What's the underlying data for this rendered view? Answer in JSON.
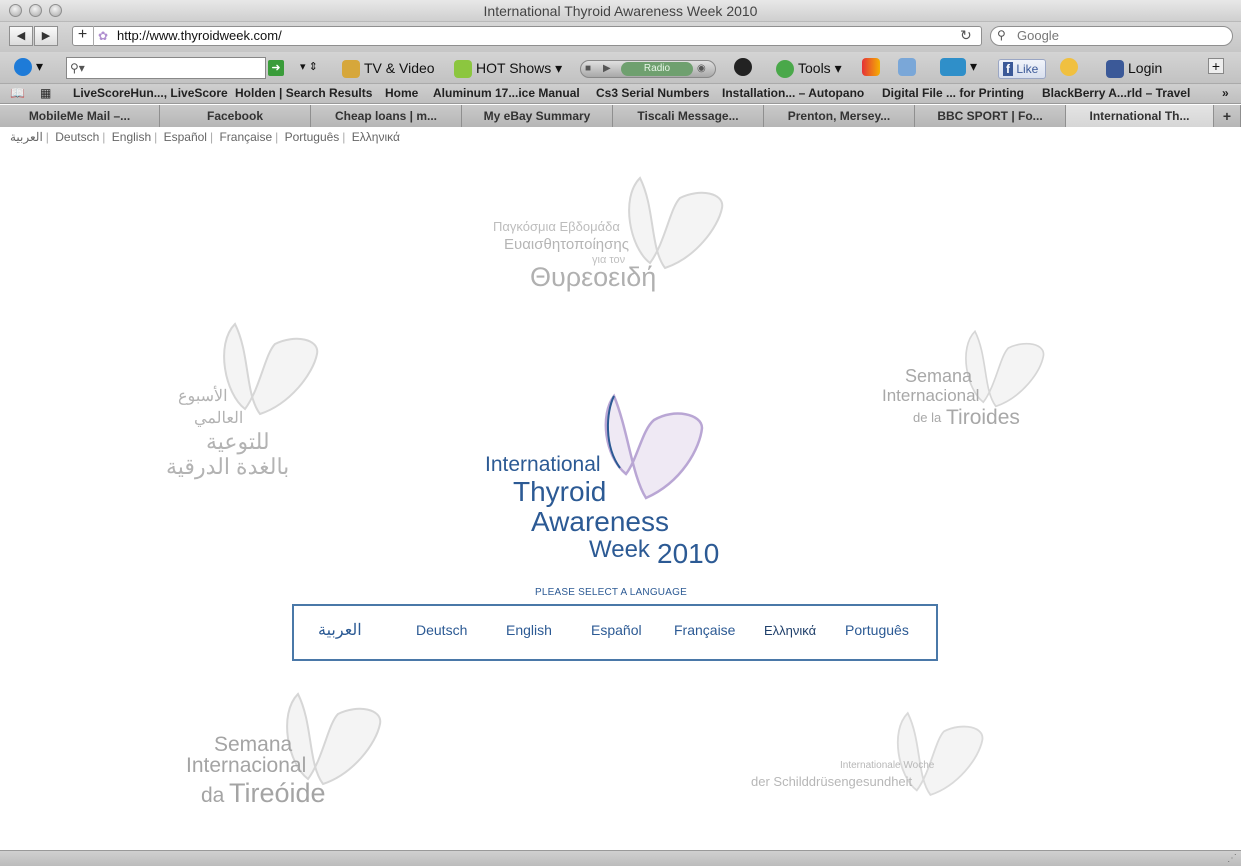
{
  "window": {
    "title": "International Thyroid Awareness Week 2010"
  },
  "address": {
    "url": "http://www.thyroidweek.com/",
    "search_placeholder": "Google"
  },
  "toolbar": {
    "tv_video": "TV & Video",
    "hot_shows": "HOT Shows",
    "radio": "Radio",
    "tools": "Tools",
    "like": "Like",
    "login": "Login"
  },
  "bookmarks": [
    "LiveScoreHun..., LiveScore",
    "Holden | Search Results",
    "Home",
    "Aluminum 17...ice Manual",
    "Cs3 Serial Numbers",
    "Installation... – Autopano",
    "Digital File ... for Printing",
    "BlackBerry A...rld – Travel"
  ],
  "tabs": [
    "MobileMe Mail –...",
    "Facebook",
    "Cheap loans | m...",
    "My eBay Summary",
    "Tiscali Message...",
    "Prenton, Mersey...",
    "BBC SPORT | Fo...",
    "International Th..."
  ],
  "top_languages": [
    "العربية",
    "Deutsch",
    "English",
    "Español",
    "Française",
    "Português",
    "Ελληνικά"
  ],
  "watermarks": {
    "greek": [
      "Παγκόσμια Εβδομάδα",
      "Ευαισθητοποίησης",
      "για τον",
      "Θυρεοειδή"
    ],
    "arabic": [
      "الأسبوع",
      "العالمي",
      "للتوعية",
      "بالغدة الدرقية"
    ],
    "spanish": [
      "Semana",
      "Internacional",
      "de la",
      "Tiroides"
    ],
    "portuguese": [
      "Semana",
      "Internacional",
      "da",
      "Tireóide"
    ],
    "german": [
      "Internationale Woche",
      "der Schilddrüsengesundheit"
    ]
  },
  "logo": {
    "line1": "International",
    "line2": "Thyroid",
    "line3": "Awareness",
    "line4a": "Week",
    "line4b": "2010"
  },
  "selector": {
    "prompt": "PLEASE SELECT A LANGUAGE",
    "options": [
      "العربية",
      "Deutsch",
      "English",
      "Español",
      "Française",
      "Ελληνικά",
      "Português"
    ]
  }
}
